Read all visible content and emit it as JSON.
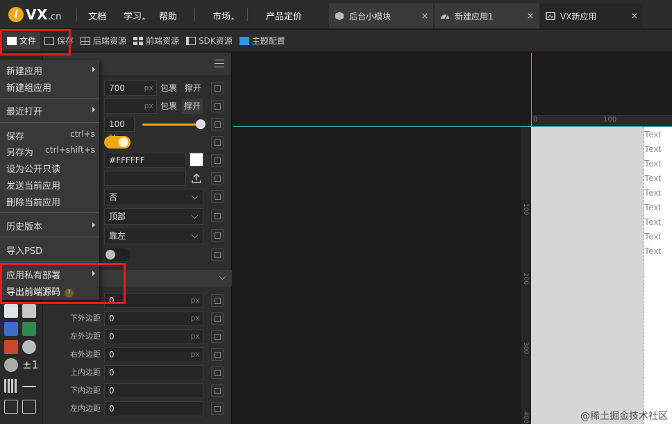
{
  "brand": {
    "mark": "i",
    "name": "VX",
    "suffix": ".cn"
  },
  "topnav": [
    {
      "label": "文档"
    },
    {
      "label": "学习"
    },
    {
      "label": "帮助"
    },
    {
      "label": "市场"
    },
    {
      "label": "产品定价"
    }
  ],
  "tabs": [
    {
      "label": "后台小模块",
      "close": "×"
    },
    {
      "label": "新建应用1",
      "close": "×"
    },
    {
      "label": "VX新应用",
      "close": "×"
    }
  ],
  "toolbar": {
    "file": "文件",
    "save": "保存",
    "backend": "后端资源",
    "frontend": "前端资源",
    "sdk": "SDK资源",
    "theme": "主题配置"
  },
  "menu": {
    "new_app": "新建应用",
    "new_group": "新建组应用",
    "recent": "最近打开",
    "save": "保存",
    "save_sc": "ctrl+s",
    "save_as": "另存为",
    "save_as_sc": "ctrl+shift+s",
    "public": "设为公开只读",
    "send": "发送当前应用",
    "delete": "删除当前应用",
    "history": "历史版本",
    "import_psd": "导入PSD",
    "private": "应用私有部署",
    "export": "导出前端源码",
    "help_mark": "?"
  },
  "panel": {
    "width_val": "700",
    "px": "px",
    "wrap": "包裹",
    "stretch": "撑开",
    "opacity": "100 %",
    "color": "#FFFFFF",
    "opt_no": "否",
    "opt_top": "顶部",
    "opt_left": "靠左",
    "margin_bottom": "下外边距",
    "margin_left": "左外边距",
    "margin_right": "右外边距",
    "padding_top": "上内边距",
    "padding_bottom": "下内边距",
    "padding_left": "左内边距",
    "zero": "0"
  },
  "canvas": {
    "ruler_h": [
      "0",
      "100"
    ],
    "ruler_v": [
      "100",
      "200",
      "300",
      "400"
    ],
    "texts": [
      "Text",
      "Text",
      "Text",
      "Text",
      "Text",
      "Text",
      "Text",
      "Text",
      "Text"
    ]
  },
  "watermark": "@稀土掘金技术社区",
  "colors": {
    "accent": "#f0a818",
    "highlight": "#e02020",
    "guide": "#2fbfb0",
    "theme_icon": "#3d8fe8"
  }
}
